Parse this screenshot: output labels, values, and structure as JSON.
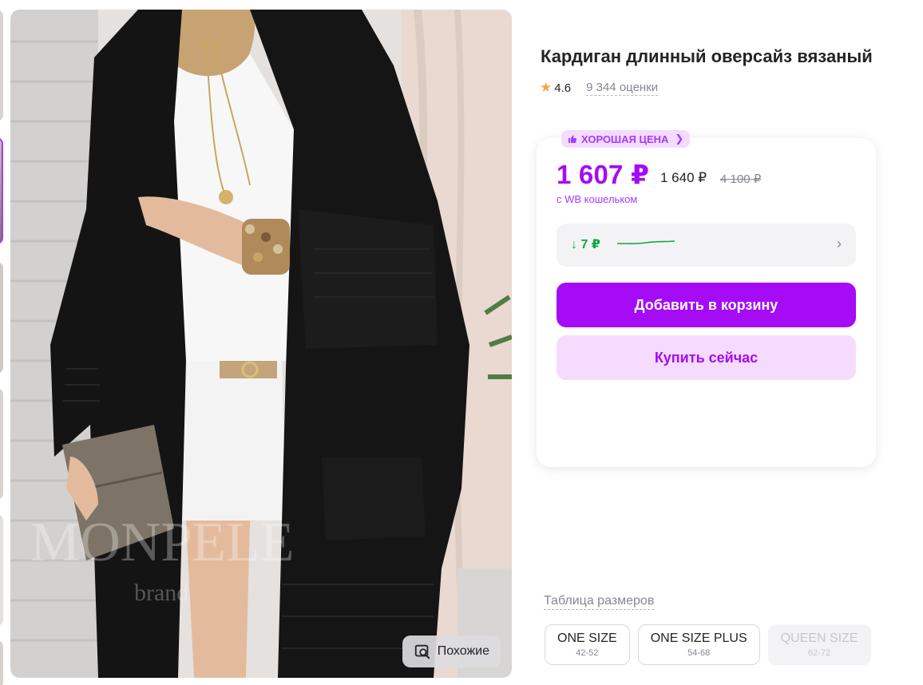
{
  "product": {
    "title": "Кардиган длинный оверсайз вязаный",
    "rating": "4.6",
    "reviews": "9 344 оценки"
  },
  "photo": {
    "watermark": "MONPELE",
    "watermark_sub": "brand",
    "similar_label": "Похожие",
    "similar_icon": "image-search-icon"
  },
  "price": {
    "badge": "ХОРОШАЯ ЦЕНА",
    "badge_icon": "thumbs-up-icon",
    "wallet_price": "1 607 ₽",
    "regular_price": "1 640 ₽",
    "old_price": "4 100 ₽",
    "wallet_note": "с WB кошельком",
    "history_delta": "↓ 7 ₽"
  },
  "actions": {
    "add_to_cart": "Добавить в корзину",
    "buy_now": "Купить сейчас"
  },
  "sizes": {
    "table_link": "Таблица размеров",
    "items": [
      {
        "name": "ONE SIZE",
        "range": "42-52",
        "available": true
      },
      {
        "name": "ONE SIZE PLUS",
        "range": "54-68",
        "available": true
      },
      {
        "name": "QUEEN SIZE",
        "range": "62-72",
        "available": false
      }
    ]
  },
  "colors": {
    "accent": "#a50bf5",
    "accent_light": "#f5dcff",
    "green": "#14a83b",
    "star": "#f6a642"
  }
}
